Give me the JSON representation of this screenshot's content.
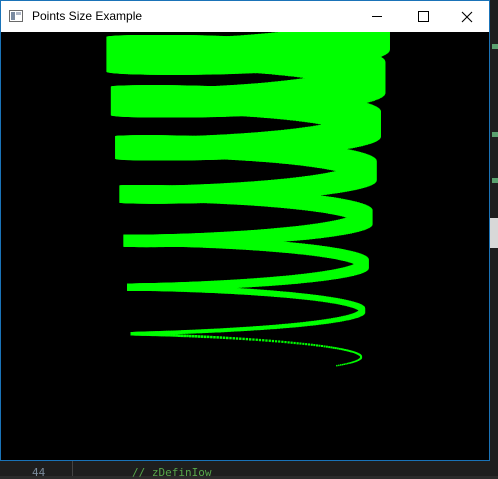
{
  "window": {
    "title": "Points Size Example",
    "icon": "app-window-icon"
  },
  "controls": {
    "minimize_icon": "minimize-icon",
    "maximize_icon": "maximize-icon",
    "close_icon": "close-icon"
  },
  "scene": {
    "background": "#000000",
    "point_color": "#00ff00"
  },
  "background_ide": {
    "line_number": "44",
    "code_snippet": "// zDefinIow"
  }
}
